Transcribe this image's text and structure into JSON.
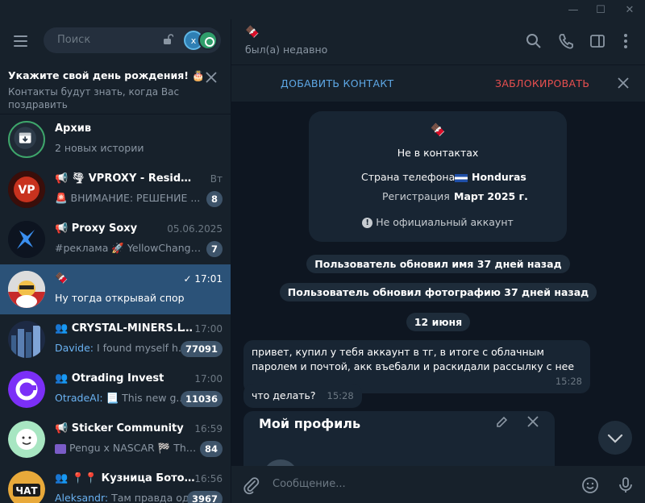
{
  "window": {
    "minimize": "—",
    "maximize": "☐",
    "close": "✕"
  },
  "left": {
    "search_placeholder": "Поиск",
    "account_initial": "x",
    "birthday": {
      "title": "Укажите свой день рождения! 🎂",
      "subtitle": "Контакты будут знать, когда Вас поздравить"
    },
    "chats": [
      {
        "name": "Архив",
        "time": "",
        "who": "",
        "message": "2 новых истории",
        "badge": "",
        "avatar_color": "#2b3a48"
      },
      {
        "name": "🌪 VPROXY - Residential ...",
        "time": "Вт",
        "who": "",
        "message": "🚨 ВНИМАНИЕ: РЕШЕНИЕ ...",
        "badge": "8",
        "avatar_color": "#c8321e"
      },
      {
        "name": "Proxy Soxy",
        "time": "05.06.2025",
        "who": "",
        "message": "#реклама 🚀 YellowChange...",
        "badge": "7",
        "avatar_color": "#111a27"
      },
      {
        "name": "",
        "time": "17:01",
        "who": "",
        "message": "Ну тогда открывай спор",
        "badge": "",
        "avatar_color": "#d6d6d6"
      },
      {
        "name": "CRYSTAL-MINERS.LTD",
        "time": "17:00",
        "who": "Davide:",
        "message": " I found myself h...",
        "badge": "77091",
        "avatar_color": "#2a3a52"
      },
      {
        "name": "Otrading Invest",
        "time": "17:00",
        "who": "OtradeAI:",
        "message": " 📃 This new g...",
        "badge": "11036",
        "avatar_color": "#7b2ff7"
      },
      {
        "name": "Sticker Community",
        "time": "16:59",
        "who": "",
        "message": "Pengu x NASCAR 🏁 The...",
        "badge": "84",
        "avatar_color": "#a8e6c2"
      },
      {
        "name": "📍📍 Кузница Ботов...",
        "time": "16:56",
        "who": "Aleksandr:",
        "message": " Там правда од...",
        "badge": "3967",
        "avatar_color": "#e8a93a"
      }
    ]
  },
  "right": {
    "contact_name": "",
    "status": "был(а) недавно",
    "add_contact": "ДОБАВИТЬ КОНТАКТ",
    "block": "ЗАБЛОКИРОВАТЬ",
    "info": {
      "not_in_contacts": "Не в контактах",
      "phone_country_label": "Страна телефона",
      "phone_country_value": "Honduras",
      "registration_label": "Регистрация",
      "registration_value": "Март 2025 г.",
      "unofficial": "Не официальный аккаунт"
    },
    "service": [
      "Пользователь обновил имя 37 дней назад",
      "Пользователь обновил фотографию 37 дней назад",
      "12 июня"
    ],
    "messages": [
      {
        "text": "привет, купил у тебя аккаунт в тг, в итоге с облачным паролем и почтой, акк въебали и раскидали рассылку с нее",
        "time": "15:28"
      },
      {
        "text": "что делать?",
        "time": "15:28"
      }
    ],
    "profile_title": "Мой профиль",
    "composer_placeholder": "Сообщение..."
  }
}
